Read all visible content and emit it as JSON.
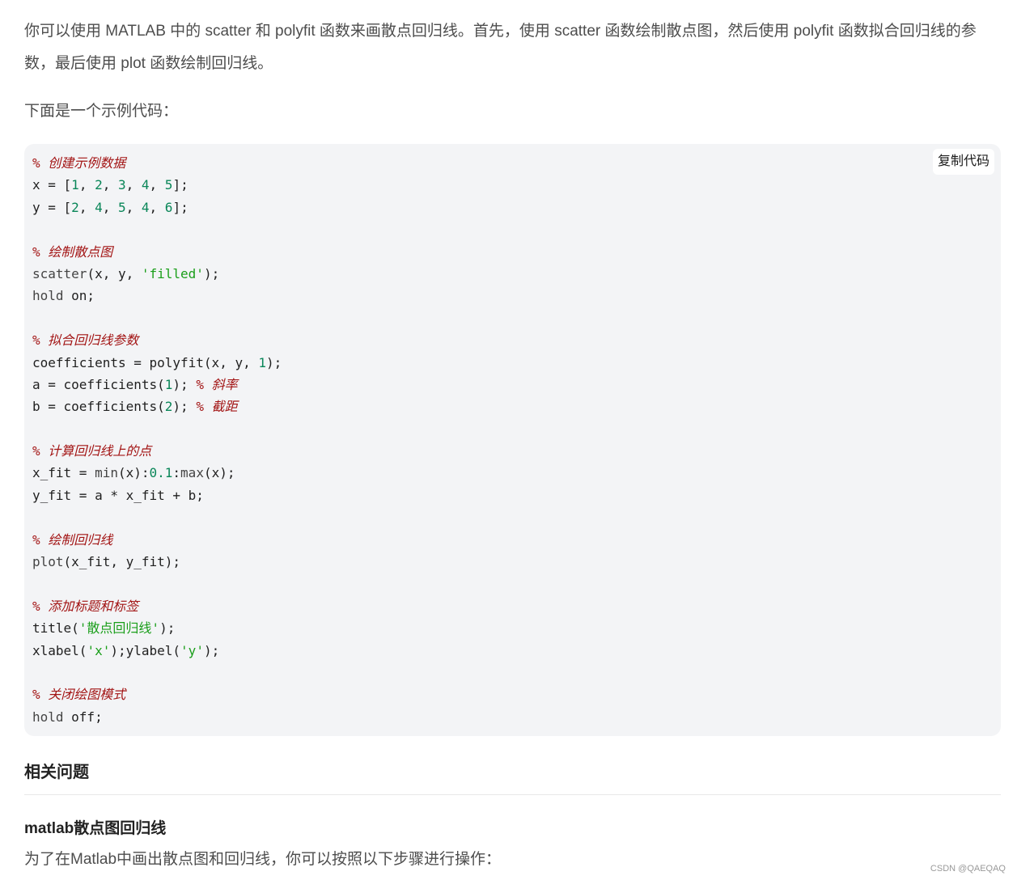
{
  "intro": "你可以使用 MATLAB 中的 scatter 和 polyfit 函数来画散点回归线。首先，使用 scatter 函数绘制散点图，然后使用 polyfit 函数拟合回归线的参数，最后使用 plot 函数绘制回归线。",
  "lead": "下面是一个示例代码：",
  "code": {
    "copy_label": "复制代码",
    "c1": "% 创建示例数据",
    "c2": "% 绘制散点图",
    "c3": "% 拟合回归线参数",
    "c4": "% 斜率",
    "c5": "% 截距",
    "c6": "% 计算回归线上的点",
    "c7": "% 绘制回归线",
    "c8": "% 添加标题和标签",
    "c9": "% 关闭绘图模式",
    "s_filled": "'filled'",
    "s_title": "'散点回归线'",
    "s_x": "'x'",
    "s_y": "'y'"
  },
  "related": {
    "heading": "相关问题",
    "item_title": "matlab散点图回归线",
    "item_text": "为了在Matlab中画出散点图和回归线，你可以按照以下步骤进行操作："
  },
  "watermark": "CSDN @QAEQAQ"
}
